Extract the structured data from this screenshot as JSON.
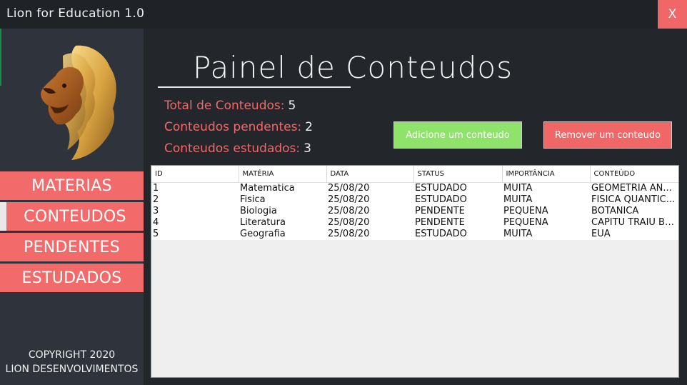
{
  "window": {
    "title": "Lion for Education 1.0",
    "close_label": "X"
  },
  "sidebar": {
    "items": [
      {
        "label": "MATERIAS"
      },
      {
        "label": "CONTEUDOS"
      },
      {
        "label": "PENDENTES"
      },
      {
        "label": "ESTUDADOS"
      }
    ],
    "copyright_line1": "COPYRIGHT 2020",
    "copyright_line2": "LION DESENVOLVIMENTOS"
  },
  "main": {
    "title": "Painel de Conteudos",
    "stats": [
      {
        "label": "Total de Conteudos:",
        "value": "5"
      },
      {
        "label": "Conteudos pendentes:",
        "value": "2"
      },
      {
        "label": "Conteudos estudados:",
        "value": "3"
      }
    ],
    "add_button": "Adicione um conteudo",
    "remove_button": "Remover um conteudo"
  },
  "table": {
    "headers": [
      "ID",
      "MATÉRIA",
      "DATA",
      "STATUS",
      "IMPORTÂNCIA",
      "CONTEÚDO"
    ],
    "rows": [
      [
        "1",
        "Matematica",
        "25/08/20",
        "ESTUDADO",
        "MUITA",
        "GEOMETRIA AN..."
      ],
      [
        "2",
        "Fisica",
        "25/08/20",
        "ESTUDADO",
        "MUITA",
        "FISICA QUANTIC..."
      ],
      [
        "3",
        "Biologia",
        "25/08/20",
        "PENDENTE",
        "PEQUENA",
        "BOTANICA"
      ],
      [
        "4",
        "Literatura",
        "25/08/20",
        "PENDENTE",
        "PEQUENA",
        "CAPITU TRAIU BE..."
      ],
      [
        "5",
        "Geografia",
        "25/08/20",
        "ESTUDADO",
        "MUITA",
        "EUA"
      ]
    ]
  },
  "colors": {
    "accent": "#f26a6a",
    "add_button": "#8fe36a",
    "background": "#23262b",
    "sidebar": "#2f343c"
  },
  "icons": {
    "logo": "lion-logo-icon"
  }
}
